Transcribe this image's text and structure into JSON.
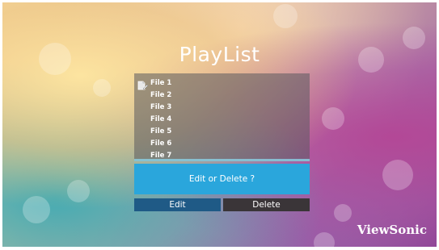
{
  "title": "PlayList",
  "files": [
    {
      "label": "File 1",
      "icon": "file-edit-icon"
    },
    {
      "label": "File 2"
    },
    {
      "label": "File 3"
    },
    {
      "label": "File 4"
    },
    {
      "label": "File 5"
    },
    {
      "label": "File 6"
    },
    {
      "label": "File 7"
    }
  ],
  "dialog": {
    "prompt": "Edit or Delete ?",
    "edit_label": "Edit",
    "delete_label": "Delete"
  },
  "brand": "ViewSonic",
  "colors": {
    "dialog": "#2aa6dc",
    "edit_button": "#1f5a86",
    "delete_button": "#3a3538"
  }
}
